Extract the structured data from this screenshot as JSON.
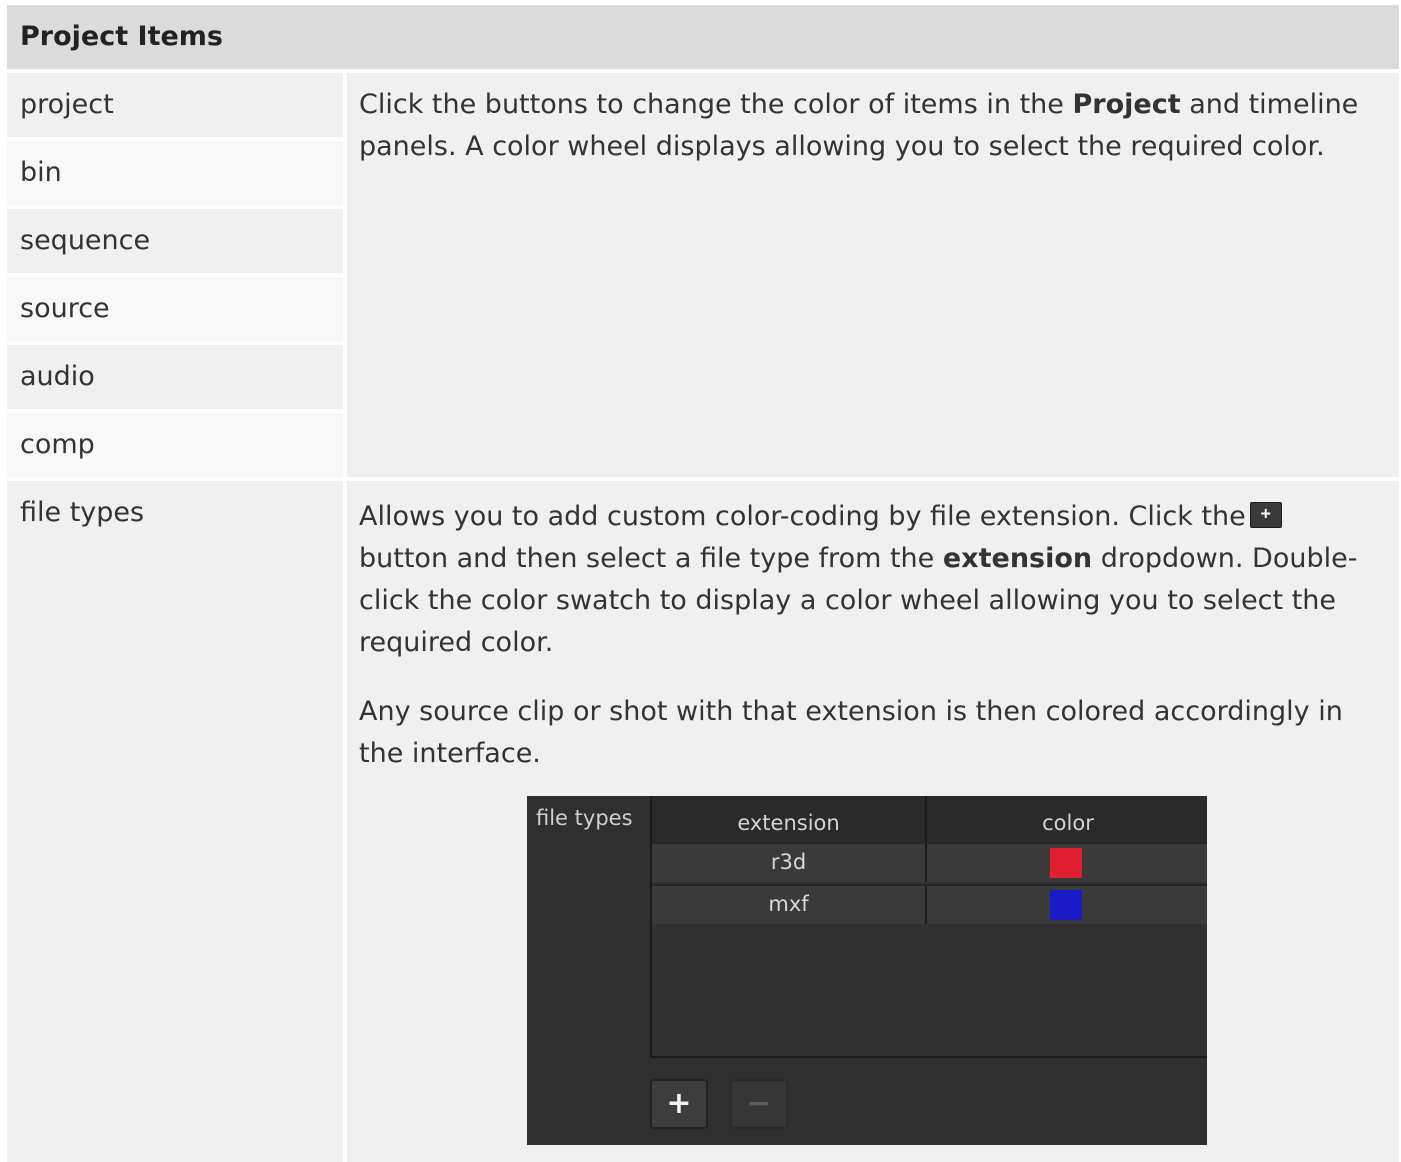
{
  "header": {
    "title": "Project Items"
  },
  "rows": [
    {
      "label": "project"
    },
    {
      "label": "bin"
    },
    {
      "label": "sequence"
    },
    {
      "label": "source"
    },
    {
      "label": "audio"
    },
    {
      "label": "comp"
    }
  ],
  "description_1": {
    "before": "Click the buttons to change the color of items in the ",
    "bold": "Project",
    "after": " and timeline panels. A color wheel displays allowing you to select the required color."
  },
  "file_types": {
    "label": "file types",
    "para1_a": "Allows you to add custom color-coding by file extension. Click the",
    "plus_icon_text": "+",
    "para1_b": " button and then select a file type from the ",
    "para1_bold": "extension",
    "para1_c": " dropdown. Double-click the color swatch to display a color wheel allowing you to select the required color.",
    "para2": "Any source clip or shot with that extension is then colored accordingly in the interface."
  },
  "panel": {
    "title": "file types",
    "columns": [
      "extension",
      "color"
    ],
    "entries": [
      {
        "extension": "r3d",
        "color": "#e0202f"
      },
      {
        "extension": "mxf",
        "color": "#1a1ac8"
      }
    ],
    "add_label": "+",
    "remove_label": "−"
  }
}
